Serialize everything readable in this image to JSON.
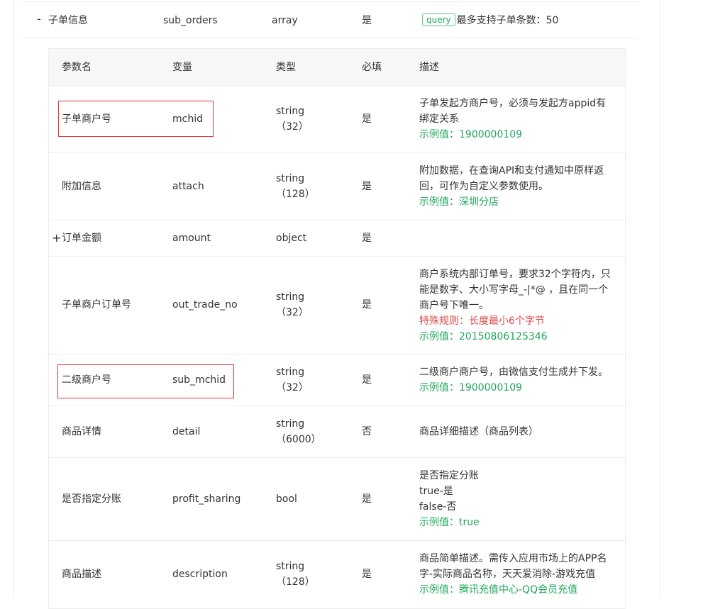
{
  "parent": {
    "toggle_symbol": "-",
    "name": "子单信息",
    "var": "sub_orders",
    "type": "array",
    "required": "是",
    "tag": "query",
    "desc": "最多支持子单条数：50"
  },
  "headers": {
    "name": "参数名",
    "var": "变量",
    "type": "类型",
    "required": "必填",
    "desc": "描述"
  },
  "rows": [
    {
      "name": "子单商户号",
      "var": "mchid",
      "type1": "string",
      "type2": "（32）",
      "required": "是",
      "desc": "子单发起方商户号，必须与发起方appid有绑定关系",
      "rule": "",
      "example": "示例值：1900000109"
    },
    {
      "name": "附加信息",
      "var": "attach",
      "type1": "string",
      "type2": "（128）",
      "required": "是",
      "desc": "附加数据，在查询API和支付通知中原样返回，可作为自定义参数使用。",
      "rule": "",
      "example": "示例值：深圳分店"
    },
    {
      "expand_symbol": "+",
      "name": "订单金额",
      "var": "amount",
      "type1": "object",
      "type2": "",
      "required": "是",
      "desc": "",
      "rule": "",
      "example": ""
    },
    {
      "name": "子单商户订单号",
      "var": "out_trade_no",
      "type1": "string",
      "type2": "（32）",
      "required": "是",
      "desc": "商户系统内部订单号，要求32个字符内，只能是数字、大小写字母_-|*@ ，且在同一个商户号下唯一。",
      "rule": "特殊规则：长度最小6个字节",
      "example": "示例值：20150806125346"
    },
    {
      "name": "二级商户号",
      "var": "sub_mchid",
      "type1": "string",
      "type2": "（32）",
      "required": "是",
      "desc": "二级商户商户号，由微信支付生成并下发。",
      "rule": "",
      "example": "示例值：1900000109"
    },
    {
      "name": "商品详情",
      "var": "detail",
      "type1": "string",
      "type2": "（6000）",
      "required": "否",
      "desc": "商品详细描述（商品列表）",
      "rule": "",
      "example": ""
    },
    {
      "name": "是否指定分账",
      "var": "profit_sharing",
      "type1": "bool",
      "type2": "",
      "required": "是",
      "desc": "是否指定分账",
      "desc2": "true-是",
      "desc3": "false-否",
      "rule": "",
      "example": "示例值：true"
    },
    {
      "name": "商品描述",
      "var": "description",
      "type1": "string",
      "type2": "（128）",
      "required": "是",
      "desc": "商品简单描述。需传入应用市场上的APP名字-实际商品名称，天天爱消除-游戏充值",
      "rule": "",
      "example": "示例值：腾讯充值中心-QQ会员充值"
    }
  ]
}
